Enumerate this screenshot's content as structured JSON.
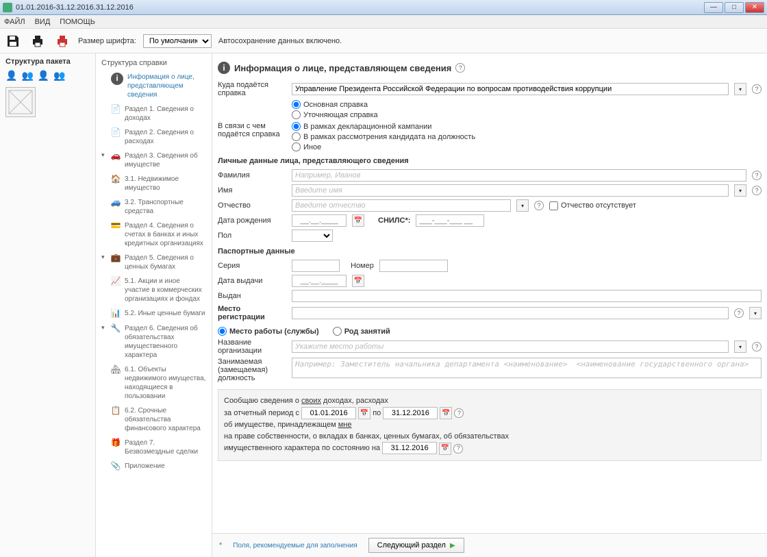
{
  "window": {
    "title": "01.01.2016-31.12.2016.31.12.2016"
  },
  "menu": {
    "file": "ФАЙЛ",
    "view": "ВИД",
    "help": "ПОМОЩЬ"
  },
  "toolbar": {
    "font_size_label": "Размер шрифта:",
    "font_size_value": "По умолчанию",
    "autosave": "Автосохранение данных включено."
  },
  "leftpanel": {
    "title": "Структура пакета"
  },
  "nav": {
    "title": "Структура справки",
    "items": [
      {
        "label": "Информация о лице, представляющем сведения"
      },
      {
        "label": "Раздел 1. Сведения о доходах"
      },
      {
        "label": "Раздел 2. Сведения о расходах"
      },
      {
        "label": "Раздел 3. Сведения об имуществе"
      },
      {
        "label": "3.1. Недвижимое имущество"
      },
      {
        "label": "3.2. Транспортные средства"
      },
      {
        "label": "Раздел 4. Сведения о счетах в банках и иных кредитных организациях"
      },
      {
        "label": "Раздел 5. Сведения о ценных бумагах"
      },
      {
        "label": "5.1. Акции и иное участие в коммерческих организациях и фондах"
      },
      {
        "label": "5.2. Иные ценные бумаги"
      },
      {
        "label": "Раздел 6. Сведения об обязательствах имущественного характера"
      },
      {
        "label": "6.1. Объекты недвижимого имущества, находящиеся в пользовании"
      },
      {
        "label": "6.2. Срочные обязательства финансового характера"
      },
      {
        "label": "Раздел 7. Безвозмездные сделки"
      },
      {
        "label": "Приложение"
      }
    ]
  },
  "page": {
    "title": "Информация о лице, представляющем сведения"
  },
  "form": {
    "where_label": "Куда подаётся справка",
    "where_value": "Управление Президента Российской Федерации по вопросам противодействия коррупции",
    "type_main": "Основная справка",
    "type_upd": "Уточняющая справка",
    "reason_label": "В связи с чем подаётся справка",
    "reason_campaign": "В рамках декларационной кампании",
    "reason_candidate": "В рамках рассмотрения кандидата на должность",
    "reason_other": "Иное",
    "personal_header": "Личные данные лица, представляющего сведения",
    "lastname_label": "Фамилия",
    "lastname_ph": "Например, Иванов",
    "firstname_label": "Имя",
    "firstname_ph": "Введите имя",
    "middlename_label": "Отчество",
    "middlename_ph": "Введите отчество",
    "no_middlename": "Отчество отсутствует",
    "birthdate_label": "Дата рождения",
    "birthdate_ph": "__.__.____",
    "snils_label": "СНИЛС*:",
    "snils_ph": "___-___-___ __",
    "gender_label": "Пол",
    "passport_header": "Паспортные данные",
    "series_label": "Серия",
    "number_label": "Номер",
    "issue_date_label": "Дата выдачи",
    "issue_date_ph": "__.__.____",
    "issued_by_label": "Выдан",
    "reg_header": "Место регистрации",
    "work_radio": "Место работы (службы)",
    "occ_radio": "Род занятий",
    "org_label": "Название организации",
    "org_ph": "Укажите место работы",
    "position_label": "Занимаемая (замещаемая) должность",
    "position_ph": "Например: Заместитель начальника департамента <наименование>  <наименование государственного органа>",
    "summary_intro": "Сообщаю сведения о",
    "summary_own": "своих",
    "summary_income": " доходах, расходах",
    "summary_period": "за отчетный период с",
    "summary_to": "по",
    "date_from": "01.01.2016",
    "date_to": "31.12.2016",
    "summary_property": "об имуществе, принадлежащем ",
    "summary_me": "мне",
    "summary_rights": "на праве собственности, о вкладах в банках, ценных бумагах, об обязательствах",
    "summary_state": "имущественного характера по состоянию на",
    "date_state": "31.12.2016"
  },
  "footer": {
    "hint": "Поля, рекомендуемые для заполнения",
    "next": "Следующий раздел"
  }
}
